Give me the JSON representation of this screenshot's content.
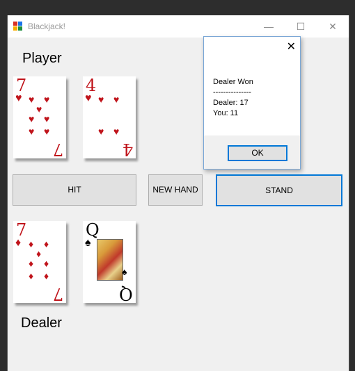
{
  "window": {
    "title": "Blackjack!",
    "minimize": "—",
    "maximize": "☐",
    "close": "✕"
  },
  "colors": {
    "accent": "#0078d7",
    "card_red": "#c0141b",
    "bg": "#f0f0f0"
  },
  "player": {
    "label": "Player",
    "cards": [
      {
        "rank": "7",
        "suit": "♥",
        "color": "red"
      },
      {
        "rank": "4",
        "suit": "♥",
        "color": "red"
      }
    ]
  },
  "dealer": {
    "label": "Dealer",
    "cards": [
      {
        "rank": "7",
        "suit": "♦",
        "color": "red"
      },
      {
        "rank": "Q",
        "suit": "♠",
        "color": "black"
      }
    ]
  },
  "buttons": {
    "hit": "HIT",
    "new_hand": "NEW HAND",
    "stand": "STAND"
  },
  "dialog": {
    "close": "✕",
    "line1": "Dealer Won",
    "line2": "---------------",
    "line3": "Dealer: 17",
    "line4": "You: 11",
    "ok": "OK"
  }
}
